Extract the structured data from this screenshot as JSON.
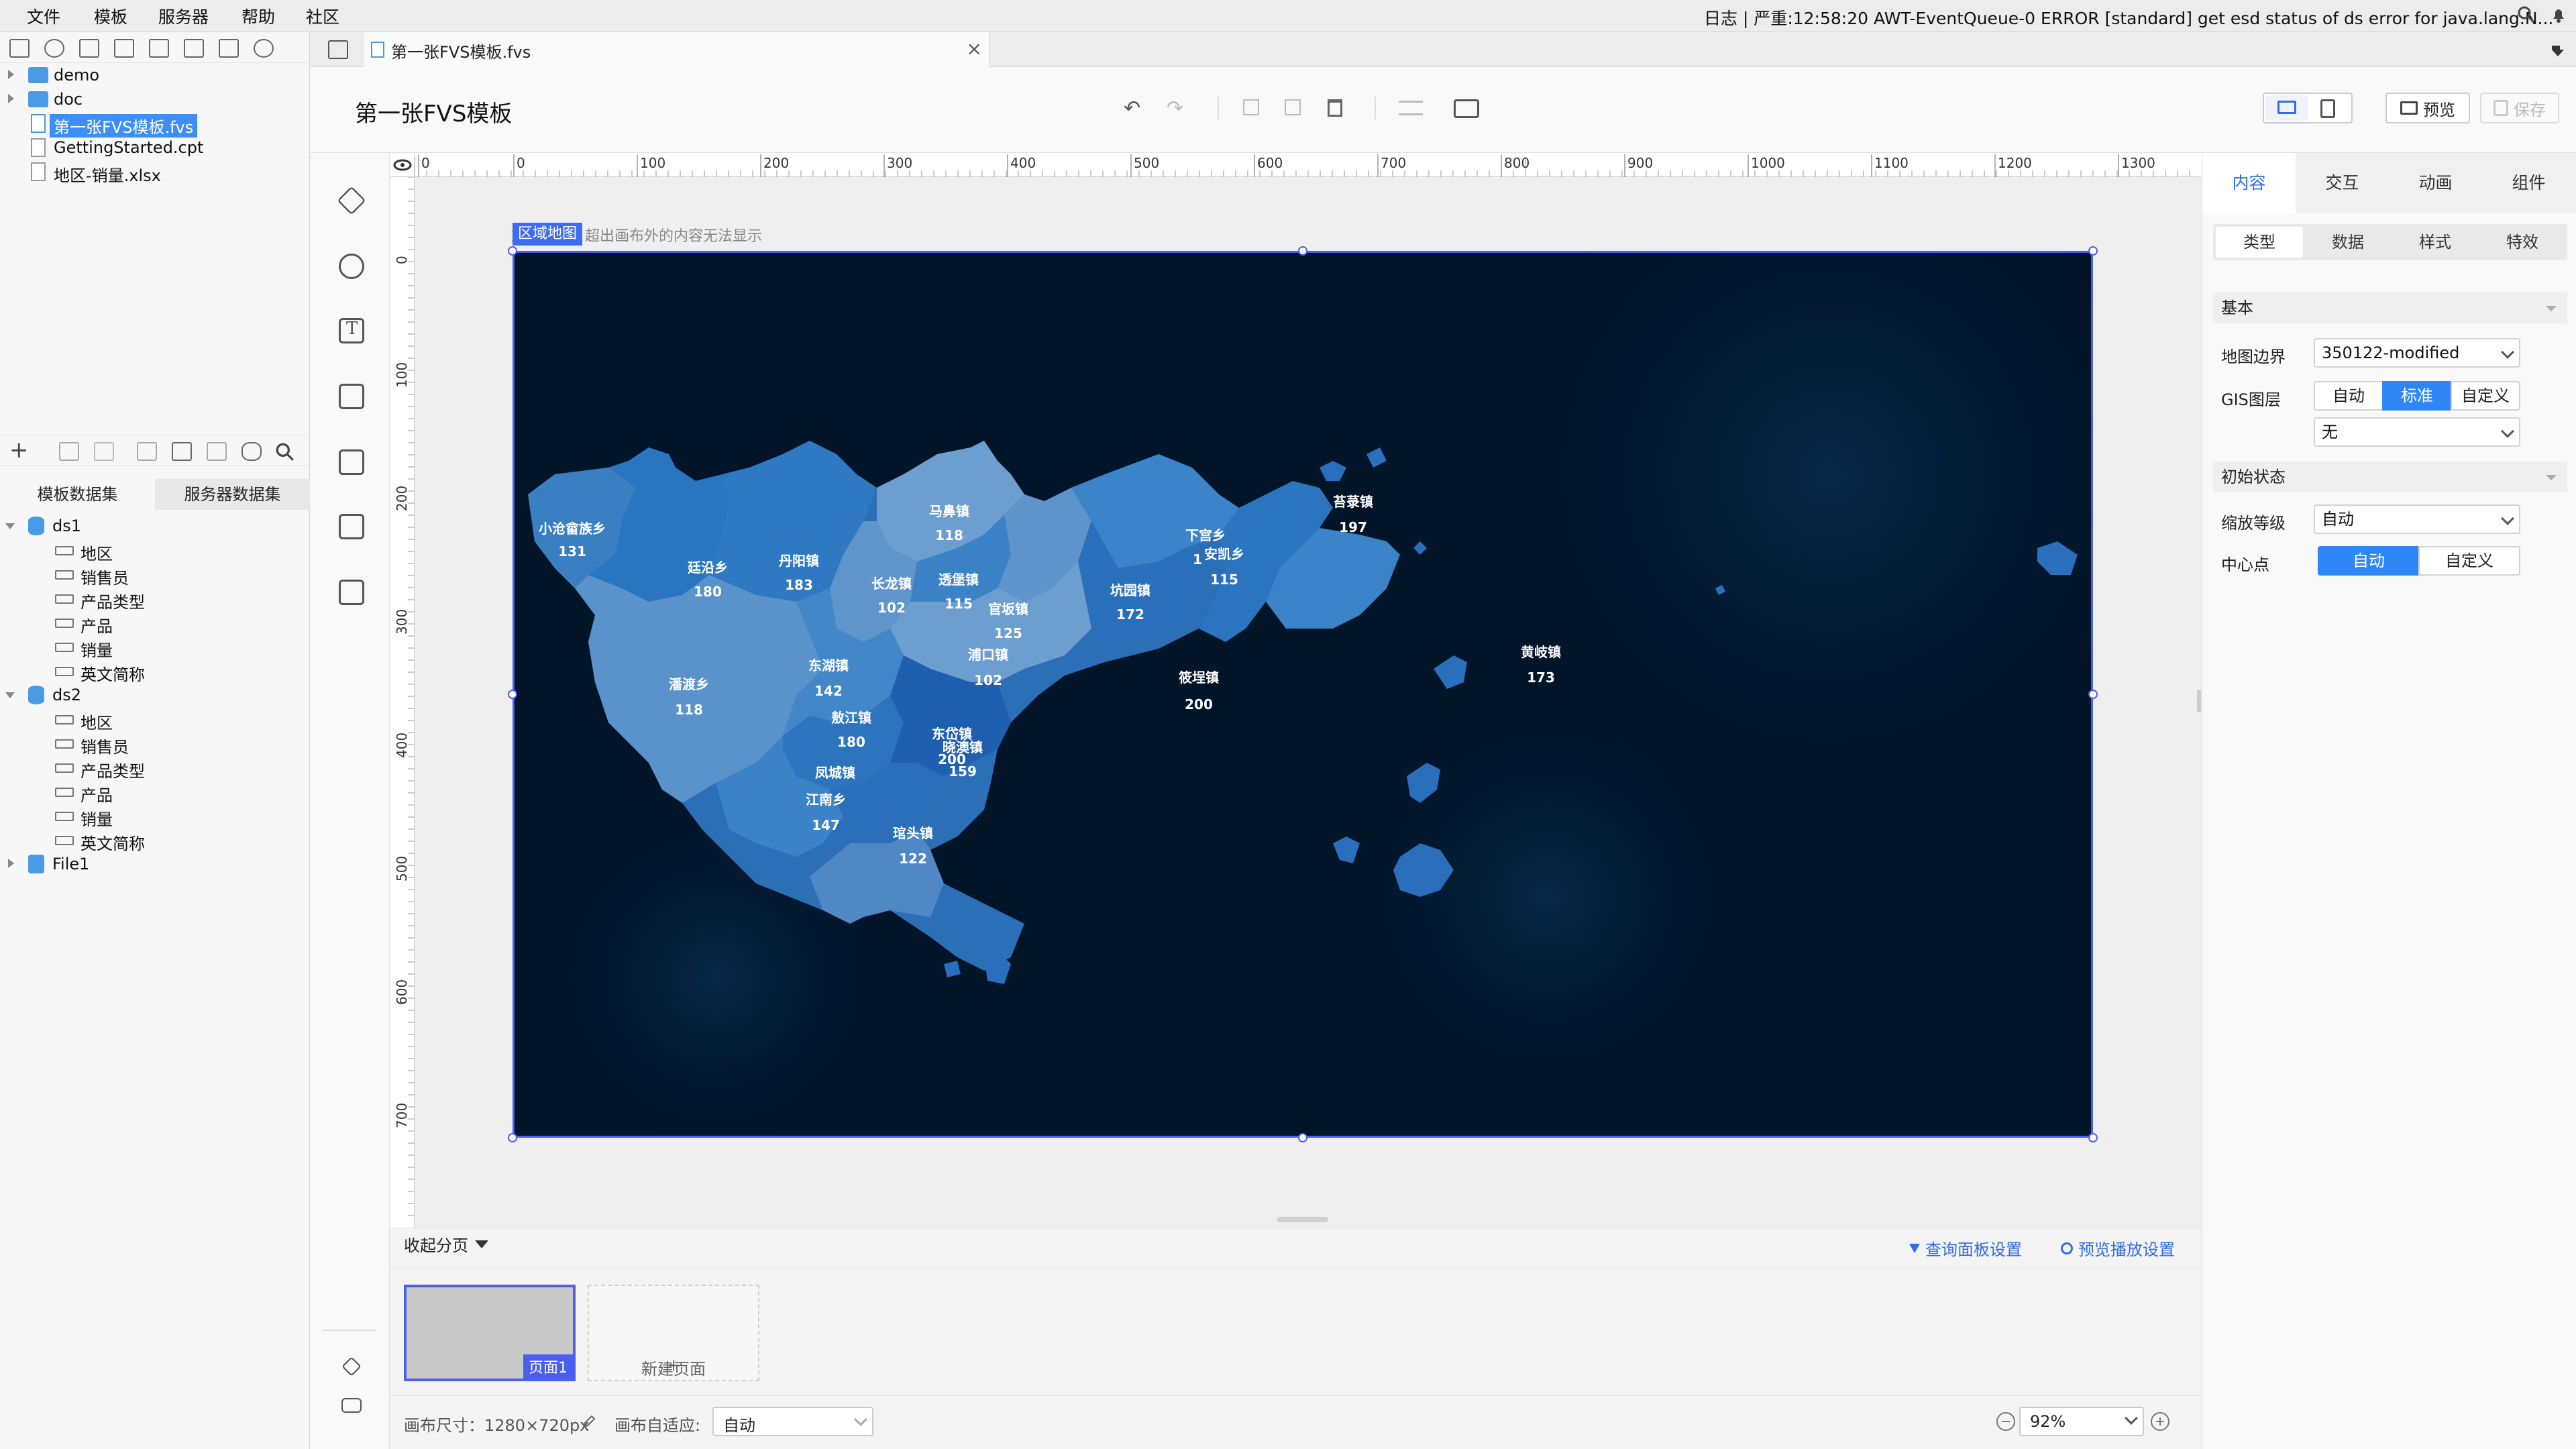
{
  "menubar": {
    "items": [
      "文件",
      "模板",
      "服务器",
      "帮助",
      "社区"
    ],
    "log": "日志 | 严重:12:58:20 AWT-EventQueue-0 ERROR [standard] get esd status of ds error for java.lang.N..."
  },
  "filetree": {
    "items": [
      {
        "label": "demo",
        "type": "folder"
      },
      {
        "label": "doc",
        "type": "folder"
      },
      {
        "label": "第一张FVS模板.fvs",
        "type": "fvs",
        "selected": true
      },
      {
        "label": "GettingStarted.cpt",
        "type": "file"
      },
      {
        "label": "地区-销量.xlsx",
        "type": "file"
      }
    ]
  },
  "datasets": {
    "tabs": [
      "模板数据集",
      "服务器数据集"
    ],
    "ds1": {
      "name": "ds1",
      "fields": [
        "地区",
        "销售员",
        "产品类型",
        "产品",
        "销量",
        "英文简称"
      ]
    },
    "ds2": {
      "name": "ds2",
      "fields": [
        "地区",
        "销售员",
        "产品类型",
        "产品",
        "销量",
        "英文简称"
      ]
    },
    "file1": "File1"
  },
  "editor_tab": {
    "title": "第一张FVS模板.fvs",
    "close": "×"
  },
  "header": {
    "title": "第一张FVS模板",
    "undo": "↶",
    "redo": "↷",
    "preview_label": "预览",
    "save_label": "保存"
  },
  "ruler": {
    "top": [
      "0",
      "0",
      "100",
      "200",
      "300",
      "400",
      "500",
      "600",
      "700",
      "800",
      "900",
      "1000",
      "1100",
      "1200",
      "1300"
    ],
    "left": [
      "0",
      "100",
      "200",
      "300",
      "400",
      "500",
      "600",
      "700"
    ]
  },
  "canvas": {
    "component_tag": "区域地图",
    "hint": "放置组件，超出画布外的内容无法显示"
  },
  "map": {
    "regions": [
      {
        "name": "小沧畲族乡",
        "value": "131"
      },
      {
        "name": "廷沿乡",
        "value": "180"
      },
      {
        "name": "丹阳镇",
        "value": "183"
      },
      {
        "name": "马鼻镇",
        "value": "118"
      },
      {
        "name": "长龙镇",
        "value": "102"
      },
      {
        "name": "透堡镇",
        "value": "115"
      },
      {
        "name": "官坂镇",
        "value": "125"
      },
      {
        "name": "下宫乡",
        "value": "1"
      },
      {
        "name": "安凯乡",
        "value": "115"
      },
      {
        "name": "坑园镇",
        "value": "172"
      },
      {
        "name": "苔菉镇",
        "value": "197"
      },
      {
        "name": "浦口镇",
        "value": "102"
      },
      {
        "name": "东湖镇",
        "value": "142"
      },
      {
        "name": "潘渡乡",
        "value": "118"
      },
      {
        "name": "敖江镇",
        "value": "180"
      },
      {
        "name": "东岱镇",
        "value": "200"
      },
      {
        "name": "晓澳镇",
        "value": "159"
      },
      {
        "name": "凤城镇",
        "value": ""
      },
      {
        "name": "江南乡",
        "value": "147"
      },
      {
        "name": "琯头镇",
        "value": "122"
      },
      {
        "name": "筱埕镇",
        "value": "200"
      },
      {
        "name": "黄岐镇",
        "value": "173"
      }
    ]
  },
  "pagebar": {
    "collapse": "收起分页",
    "query_panel": "查询面板设置",
    "preview_play": "预览播放设置",
    "page1": "页面1",
    "new_page": "新建页面"
  },
  "statusbar": {
    "canvas_size": "画布尺寸：1280×720px",
    "adapt_label": "画布自适应:",
    "adapt_value": "自动",
    "zoom": "92%"
  },
  "rightpanel": {
    "tabs": [
      "内容",
      "交互",
      "动画",
      "组件"
    ],
    "subtabs": [
      "类型",
      "数据",
      "样式",
      "特效"
    ],
    "basic": "基本",
    "map_boundary_label": "地图边界",
    "map_boundary_value": "350122-modified",
    "gis_label": "GIS图层",
    "gis_options": [
      "自动",
      "标准",
      "自定义"
    ],
    "gis_select": "无",
    "initial_state": "初始状态",
    "zoom_level_label": "缩放等级",
    "zoom_level_value": "自动",
    "center_label": "中心点",
    "center_options": [
      "自动",
      "自定义"
    ]
  },
  "colors": {
    "accent": "#2f86f6",
    "selection": "#4a5ef0",
    "map_bg": "#02162b"
  }
}
